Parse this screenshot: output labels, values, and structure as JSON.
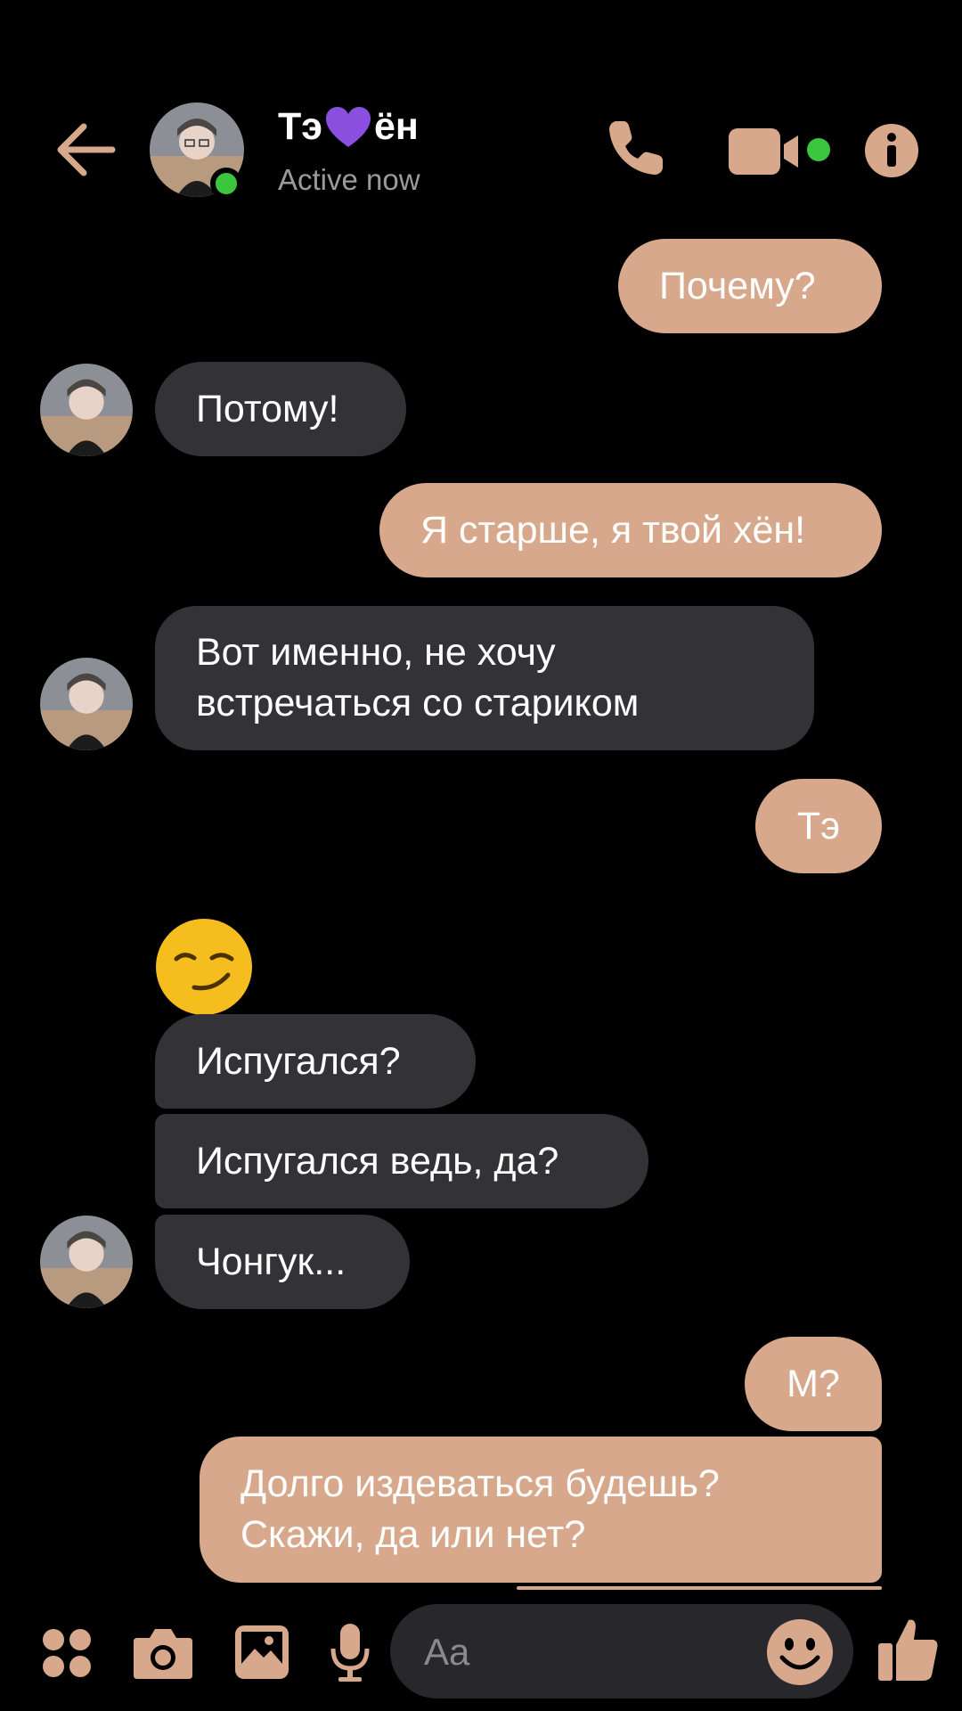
{
  "colors": {
    "accent": "#d7a88b",
    "incoming_bubble": "#333236",
    "online": "#3cc63f",
    "heart": "#8b4fe0"
  },
  "header": {
    "name_part1": "Тэ",
    "name_heart_icon": "purple-heart-emoji",
    "name_part2": "ён",
    "status": "Active now",
    "icons": [
      "back-arrow-icon",
      "phone-icon",
      "video-camera-icon",
      "info-icon"
    ]
  },
  "messages": [
    {
      "dir": "out",
      "text": "Почему?"
    },
    {
      "dir": "in",
      "text": "Потому!"
    },
    {
      "dir": "out",
      "text": "Я старше, я твой хён!"
    },
    {
      "dir": "in",
      "lines": [
        "Вот именно, не хочу",
        "встречаться со стариком"
      ]
    },
    {
      "dir": "out",
      "text": "Тэ"
    },
    {
      "dir": "in",
      "emoji": "smirking-face-emoji"
    },
    {
      "dir": "in",
      "text": "Испугался?"
    },
    {
      "dir": "in",
      "text": "Испугался ведь, да?"
    },
    {
      "dir": "in",
      "text": "Чонгук..."
    },
    {
      "dir": "out",
      "text": "М?"
    },
    {
      "dir": "out",
      "lines": [
        "Долго издеваться будешь?",
        "Скажи, да или нет?"
      ]
    }
  ],
  "composer": {
    "placeholder": "Aa",
    "icons": [
      "apps-grid-icon",
      "camera-icon",
      "gallery-icon",
      "microphone-icon",
      "emoji-icon",
      "thumbs-up-icon"
    ]
  }
}
